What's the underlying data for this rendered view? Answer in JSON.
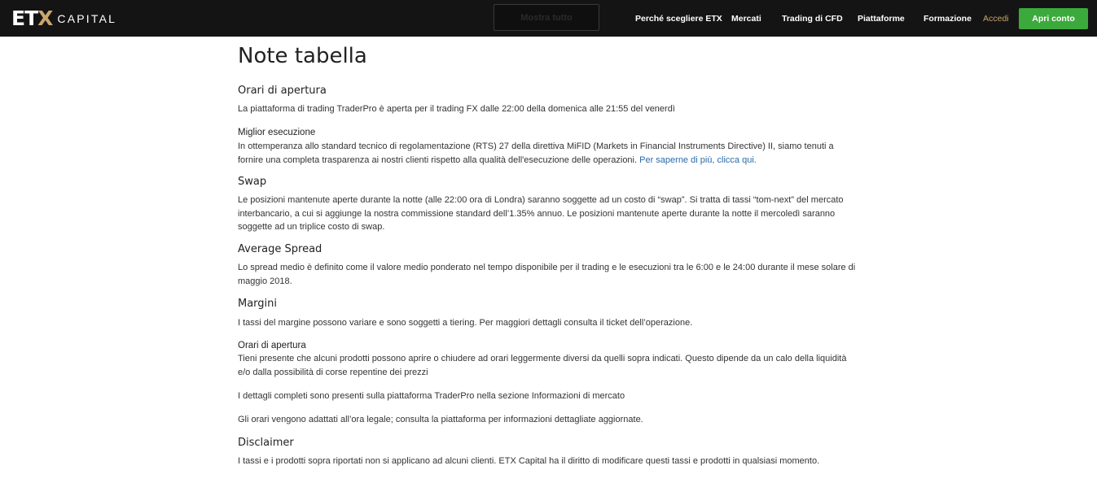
{
  "header": {
    "logo_mark_left": "ET",
    "logo_mark_x": "X",
    "logo_text": "CAPITAL",
    "show_button_label": "Mostra tutto",
    "nav": [
      {
        "label": "Perché scegliere ETX"
      },
      {
        "label": "Mercati"
      },
      {
        "label": "Trading di CFD"
      },
      {
        "label": "Piattaforme"
      },
      {
        "label": "Formazione"
      }
    ],
    "login_label": "Accedi",
    "open_account_label": "Apri conto",
    "colors": {
      "bar": "#141414",
      "accent": "#c9a66b",
      "open_button": "#3ca93c",
      "link": "#2a6aa8"
    }
  },
  "main": {
    "title": "Note tabella",
    "sections": {
      "orari_heading": "Orari di apertura",
      "orari_text": "La piattaforma di trading TraderPro è aperta per il trading FX dalle 22:00 della domenica alle 21:55 del venerdì",
      "best_exec_heading": "Miglior esecuzione",
      "best_exec_text": "In ottemperanza allo standard tecnico di regolamentazione (RTS) 27 della direttiva MiFID (Markets in Financial Instruments Directive) II, siamo tenuti a fornire una completa trasparenza ai nostri clienti rispetto alla qualità dell'esecuzione delle operazioni.",
      "best_exec_link": "Per saperne di più, clicca qui.",
      "swap_heading": "Swap",
      "swap_text": "Le posizioni mantenute aperte durante la notte (alle 22:00 ora di Londra) saranno soggette ad un costo di “swap”. Si tratta di tassi “tom-next” del mercato interbancario, a cui si aggiunge la nostra commissione standard dell’1.35% annuo. Le posizioni mantenute aperte durante la notte il mercoledì saranno soggette ad un triplice costo di swap.",
      "spread_heading": "Average Spread",
      "spread_text": "Lo spread medio è definito come il valore medio ponderato nel tempo disponibile per il trading e le esecuzioni tra le 6:00 e le 24:00 durante il mese solare di maggio 2018.",
      "margini_heading": "Margini",
      "margini_text": "I tassi del margine possono variare e sono soggetti a tiering. Per maggiori dettagli consulta il ticket dell’operazione.",
      "orari2_heading": "Orari di apertura",
      "orari2_text": "Tieni presente che alcuni prodotti possono aprire o chiudere ad orari leggermente diversi da quelli sopra indicati. Questo dipende da un calo della liquidità e/o dalla possibilità di corse repentine dei prezzi",
      "details_text": "I dettagli completi sono presenti sulla piattaforma TraderPro nella sezione Informazioni di mercato",
      "legal_text": "Gli orari vengono adattati all’ora legale; consulta la piattaforma per informazioni dettagliate aggiornate.",
      "disclaimer_heading": "Disclaimer",
      "disclaimer_text": "I tassi e i prodotti sopra riportati non si applicano ad alcuni clienti. ETX Capital ha il diritto di modificare questi tassi e prodotti in qualsiasi momento."
    }
  }
}
